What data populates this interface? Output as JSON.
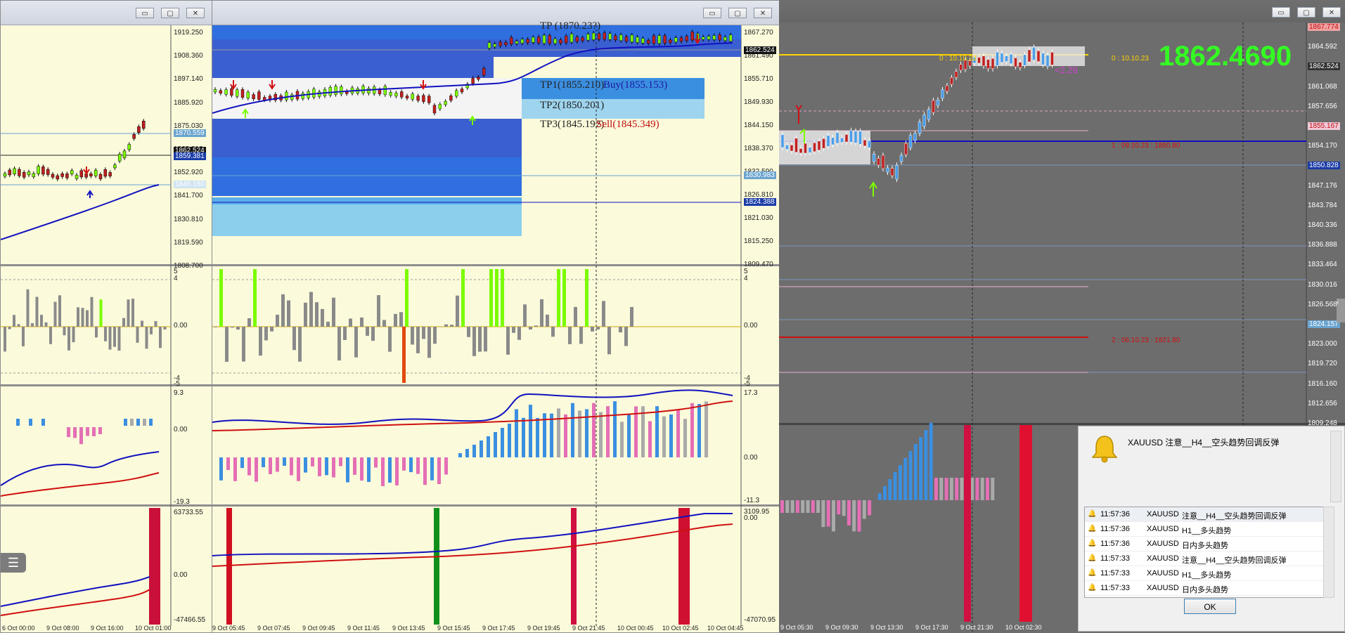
{
  "windows": {
    "left": {
      "buttons": {
        "minimize": "▭",
        "maximize": "▢",
        "close": "✕"
      },
      "price_scale": [
        "1919.250",
        "1908.360",
        "1897.140",
        "1885.920",
        "1875.030",
        "1863.810",
        "1852.920",
        "1841.700",
        "1830.810",
        "1819.590",
        "1808.700"
      ],
      "tags": {
        "a": "1870.559",
        "b": "1862.524",
        "c": "1859.381",
        "d": "1846.180"
      },
      "sub1_scale": [
        "5",
        "4",
        "0.00",
        "-4",
        "-5"
      ],
      "sub2_scale": [
        "9.3",
        "0.00",
        "-19.3"
      ],
      "sub3_scale": [
        "63733.55",
        "0.00",
        "-47466.55"
      ],
      "time_axis": [
        "6 Oct 00:00",
        "9 Oct 08:00",
        "9 Oct 16:00",
        "10 Oct 01:00"
      ]
    },
    "middle": {
      "buttons": {
        "minimize": "▭",
        "maximize": "▢",
        "close": "✕"
      },
      "price_scale": [
        "1867.270",
        "1861.490",
        "1855.710",
        "1849.930",
        "1844.150",
        "1838.370",
        "1832.590",
        "1826.810",
        "1821.030",
        "1815.250",
        "1809.470"
      ],
      "tags": {
        "a": "1862.524",
        "b": "1830.983",
        "c": "1824.388"
      },
      "overlay": {
        "tp0": "TP (1870.23?)",
        "tp1": "TP1(1855.210)",
        "buy": "Buy(1855.153)",
        "tp2": "TP2(1850.201)",
        "tp3": "TP3(1845.192)",
        "sell": "Sell(1845.349)"
      },
      "sub1_scale": [
        "5",
        "4",
        "0.00",
        "-4",
        "-5"
      ],
      "sub2_scale": [
        "17.3",
        "0.00",
        "-11.3"
      ],
      "sub3_scale": [
        "3109.95",
        "0.00",
        "-47070.95"
      ],
      "time_axis": [
        "9 Oct 05:45",
        "9 Oct 07:45",
        "9 Oct 09:45",
        "9 Oct 11:45",
        "9 Oct 13:45",
        "9 Oct 15:45",
        "9 Oct 17:45",
        "9 Oct 19:45",
        "9 Oct 21:45",
        "10 Oct 00:45",
        "10 Oct 02:45",
        "10 Oct 04:45"
      ]
    },
    "right": {
      "buttons": {
        "minimize": "▭",
        "maximize": "▢",
        "close": "✕"
      },
      "big_price": "1862.4690",
      "price_scale": [
        "1867.774",
        "1864.592",
        "1862.524",
        "1861.068",
        "1857.656",
        "1855.167",
        "1854.170",
        "1850.828",
        "1847.176",
        "1843.784",
        "1840.336",
        "1836.888",
        "1833.464",
        "1830.016",
        "1826.568",
        "1824.157",
        "1823.000",
        "1819.720",
        "1816.160",
        "1812.656",
        "1809.248"
      ],
      "level_labels": {
        "l0": "0 : 10.10.23",
        "l1": "1 : 09.10.23 : 1850.80",
        "l2": "2 : 06.10.23 : 1821.80",
        "delta": "<2.26",
        "l0_short": "0 : 10.10.23"
      },
      "time_axis": [
        "9 Oct 05:30",
        "9 Oct 09:30",
        "9 Oct 13:30",
        "9 Oct 17:30",
        "9 Oct 21:30",
        "10 Oct 02:30"
      ]
    }
  },
  "alert": {
    "message": "XAUUSD 注意__H4__空头趋势回调反弹",
    "rows": [
      {
        "time": "11:57:36",
        "symbol": "XAUUSD",
        "text": "注意__H4__空头趋势回调反弹"
      },
      {
        "time": "11:57:36",
        "symbol": "XAUUSD",
        "text": "H1__多头趋势"
      },
      {
        "time": "11:57:36",
        "symbol": "XAUUSD",
        "text": "日内多头趋势"
      },
      {
        "time": "11:57:33",
        "symbol": "XAUUSD",
        "text": "注意__H4__空头趋势回调反弹"
      },
      {
        "time": "11:57:33",
        "symbol": "XAUUSD",
        "text": "H1__多头趋势"
      },
      {
        "time": "11:57:33",
        "symbol": "XAUUSD",
        "text": "日内多头趋势"
      }
    ],
    "ok_label": "OK"
  },
  "colors": {
    "chart_bg": "#fbfadb",
    "dark_bg": "#6d6d6d",
    "blue_line": "#1010c0",
    "red_line": "#d01010",
    "bull_green": "#7cfc00",
    "bar_gray": "#8a8a8a",
    "hist_blue": "#3b8fe0",
    "hist_pink": "#e46fb5",
    "big_price": "#33ff22"
  }
}
